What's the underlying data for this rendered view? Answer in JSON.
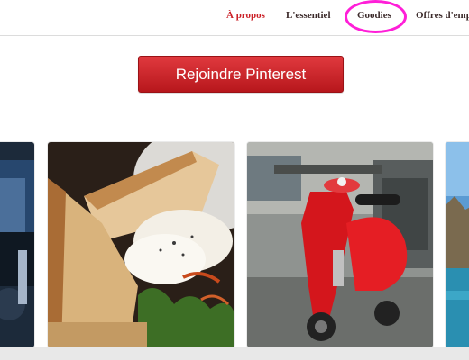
{
  "nav": {
    "items": [
      {
        "label": "À propos",
        "active": true
      },
      {
        "label": "L'essentiel",
        "active": false
      },
      {
        "label": "Goodies",
        "active": false
      },
      {
        "label": "Offres d'emp",
        "active": false
      }
    ]
  },
  "cta": {
    "label": "Rejoindre Pinterest"
  },
  "colors": {
    "accent": "#cb2027",
    "highlight": "#ff1fd8"
  }
}
